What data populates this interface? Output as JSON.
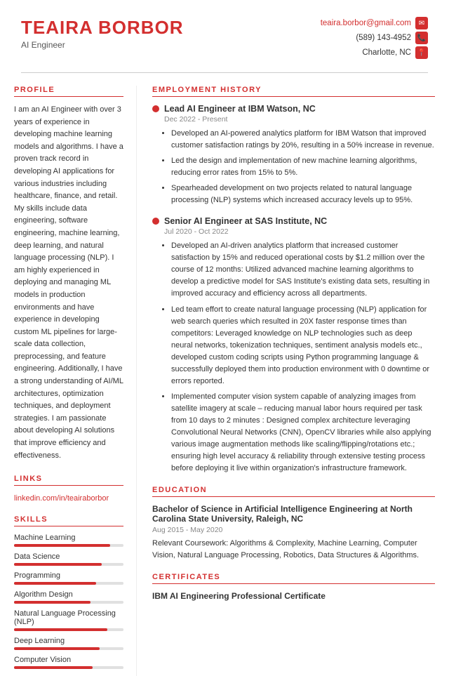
{
  "header": {
    "name": "TEAIRA BORBOR",
    "title": "AI Engineer",
    "email": "teaira.borbor@gmail.com",
    "phone": "(589) 143-4952",
    "location": "Charlotte, NC"
  },
  "profile": {
    "section_title": "PROFILE",
    "text": "I am an AI Engineer with over 3 years of experience in developing machine learning models and algorithms. I have a proven track record in developing AI applications for various industries including healthcare, finance, and retail. My skills include data engineering, software engineering, machine learning, deep learning, and natural language processing (NLP). I am highly experienced in deploying and managing ML models in production environments and have experience in developing custom ML pipelines for large-scale data collection, preprocessing, and feature engineering. Additionally, I have a strong understanding of AI/ML architectures, optimization techniques, and deployment strategies. I am passionate about developing AI solutions that improve efficiency and effectiveness."
  },
  "links": {
    "section_title": "LINKS",
    "linkedin": "linkedin.com/in/teairaborbor"
  },
  "skills": {
    "section_title": "SKILLS",
    "items": [
      {
        "name": "Machine Learning",
        "pct": 88
      },
      {
        "name": "Data Science",
        "pct": 80
      },
      {
        "name": "Programming",
        "pct": 75
      },
      {
        "name": "Algorithm Design",
        "pct": 70
      },
      {
        "name": "Natural Language Processing (NLP)",
        "pct": 85
      },
      {
        "name": "Deep Learning",
        "pct": 78
      },
      {
        "name": "Computer Vision",
        "pct": 72
      }
    ]
  },
  "employment": {
    "section_title": "EMPLOYMENT HISTORY",
    "jobs": [
      {
        "title": "Lead AI Engineer at IBM Watson, NC",
        "dates": "Dec 2022 - Present",
        "bullets": [
          "Developed an AI-powered analytics platform for IBM Watson that improved customer satisfaction ratings by 20%, resulting in a 50% increase in revenue.",
          "Led the design and implementation of new machine learning algorithms, reducing error rates from 15% to 5%.",
          "Spearheaded development on two projects related to natural language processing (NLP) systems which increased accuracy levels up to 95%."
        ]
      },
      {
        "title": "Senior AI Engineer at SAS Institute, NC",
        "dates": "Jul 2020 - Oct 2022",
        "bullets": [
          "Developed an AI-driven analytics platform that increased customer satisfaction by 15% and reduced operational costs by $1.2 million over the course of 12 months: Utilized advanced machine learning algorithms to develop a predictive model for SAS Institute's existing data sets, resulting in improved accuracy and efficiency across all departments.",
          "Led team effort to create natural language processing (NLP) application for web search queries which resulted in 20X faster response times than competitors: Leveraged knowledge on NLP technologies such as deep neural networks, tokenization techniques, sentiment analysis models etc., developed custom coding scripts using Python programming language & successfully deployed them into production environment with 0 downtime or errors reported.",
          "Implemented computer vision system capable of analyzing images from satellite imagery at scale – reducing manual labor hours required per task from 10 days to 2 minutes : Designed complex architecture leveraging Convolutional Neural Networks (CNN), OpenCV libraries while also applying various image augmentation methods like scaling/flipping/rotations etc.; ensuring high level accuracy & reliability through extensive testing process before deploying it live within organization's infrastructure framework."
        ]
      }
    ]
  },
  "education": {
    "section_title": "EDUCATION",
    "degree": "Bachelor of Science in Artificial Intelligence Engineering at North Carolina State University, Raleigh, NC",
    "dates": "Aug 2015 - May 2020",
    "courses": "Relevant Coursework: Algorithms & Complexity, Machine Learning, Computer Vision, Natural Language Processing, Robotics, Data Structures & Algorithms."
  },
  "certificates": {
    "section_title": "CERTIFICATES",
    "title": "IBM AI Engineering Professional Certificate"
  }
}
